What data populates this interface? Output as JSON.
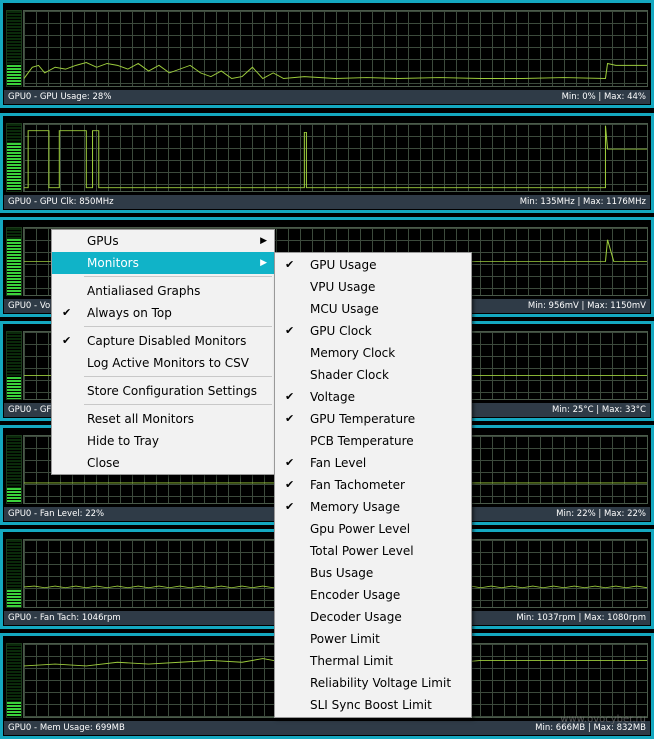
{
  "monitors": [
    {
      "label": "GPU0 - GPU Usage: 28%",
      "range": "Min: 0% | Max: 44%",
      "level": 0.28
    },
    {
      "label": "GPU0 - GPU Clk: 850MHz",
      "range": "Min: 135MHz | Max: 1176MHz",
      "level": 0.72
    },
    {
      "label": "GPU0 - Vo",
      "range": "Min: 956mV | Max: 1150mV",
      "level": 0.83
    },
    {
      "label": "GPU0 - GF",
      "range": "Min: 25°C | Max: 33°C",
      "level": 0.33
    },
    {
      "label": "GPU0 - Fan Level: 22%",
      "range": "Min: 22% | Max: 22%",
      "level": 0.22
    },
    {
      "label": "GPU0 - Fan Tach: 1046rpm",
      "range": "Min: 1037rpm | Max: 1080rpm",
      "level": 0.25
    },
    {
      "label": "GPU0 - Mem Usage: 699MB",
      "range": "Min: 666MB | Max: 832MB",
      "level": 0.2
    }
  ],
  "context_menu": {
    "gpus": "GPUs",
    "monitors": "Monitors",
    "antialiased": "Antialiased Graphs",
    "always_on_top": "Always on Top",
    "capture_disabled": "Capture Disabled Monitors",
    "log_csv": "Log Active Monitors to CSV",
    "store_config": "Store Configuration Settings",
    "reset_all": "Reset all Monitors",
    "hide_tray": "Hide to Tray",
    "close": "Close",
    "check_glyph": "✔",
    "arrow_glyph": "▶"
  },
  "submenu": [
    {
      "label": "GPU Usage",
      "checked": true
    },
    {
      "label": "VPU Usage",
      "checked": false
    },
    {
      "label": "MCU Usage",
      "checked": false
    },
    {
      "label": "GPU Clock",
      "checked": true
    },
    {
      "label": "Memory Clock",
      "checked": false
    },
    {
      "label": "Shader Clock",
      "checked": false
    },
    {
      "label": "Voltage",
      "checked": true
    },
    {
      "label": "GPU Temperature",
      "checked": true
    },
    {
      "label": "PCB Temperature",
      "checked": false
    },
    {
      "label": "Fan Level",
      "checked": true
    },
    {
      "label": "Fan Tachometer",
      "checked": true
    },
    {
      "label": "Memory Usage",
      "checked": true
    },
    {
      "label": "Gpu Power Level",
      "checked": false
    },
    {
      "label": "Total Power Level",
      "checked": false
    },
    {
      "label": "Bus Usage",
      "checked": false
    },
    {
      "label": "Encoder Usage",
      "checked": false
    },
    {
      "label": "Decoder Usage",
      "checked": false
    },
    {
      "label": "Power Limit",
      "checked": false
    },
    {
      "label": "Thermal Limit",
      "checked": false
    },
    {
      "label": "Reliability Voltage Limit",
      "checked": false
    },
    {
      "label": "SLI Sync Boost Limit",
      "checked": false
    }
  ],
  "colors": {
    "accent": "#10b3c8",
    "trace": "#9ccc3c",
    "grid": "#3c4a3c",
    "status_bar": "#2f3b47"
  }
}
